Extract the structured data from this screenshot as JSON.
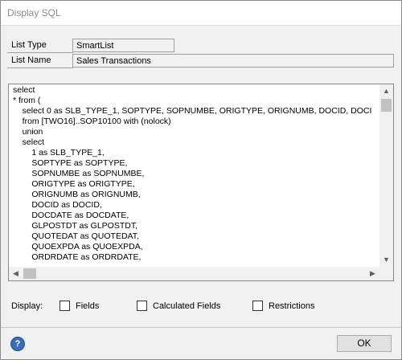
{
  "window": {
    "title": "Display SQL"
  },
  "fields": {
    "list_type_label": "List Type",
    "list_type_value": "SmartList",
    "list_name_label": "List Name",
    "list_name_value": "Sales Transactions"
  },
  "sql": {
    "lines": [
      "select",
      "* from (",
      "    select 0 as SLB_TYPE_1, SOPTYPE, SOPNUMBE, ORIGTYPE, ORIGNUMB, DOCID, DOCI",
      "    from [TWO16]..SOP10100 with (nolock)",
      "    union",
      "    select",
      "        1 as SLB_TYPE_1,",
      "        SOPTYPE as SOPTYPE,",
      "        SOPNUMBE as SOPNUMBE,",
      "        ORIGTYPE as ORIGTYPE,",
      "        ORIGNUMB as ORIGNUMB,",
      "        DOCID as DOCID,",
      "        DOCDATE as DOCDATE,",
      "        GLPOSTDT as GLPOSTDT,",
      "        QUOTEDAT as QUOTEDAT,",
      "        QUOEXPDA as QUOEXPDA,",
      "        ORDRDATE as ORDRDATE,"
    ]
  },
  "display": {
    "label": "Display:",
    "options": [
      {
        "label": "Fields",
        "checked": false
      },
      {
        "label": "Calculated Fields",
        "checked": false
      },
      {
        "label": "Restrictions",
        "checked": false
      }
    ]
  },
  "footer": {
    "ok_label": "OK",
    "help_icon": "help-icon"
  }
}
